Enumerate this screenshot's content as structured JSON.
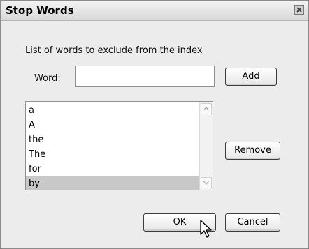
{
  "dialog": {
    "title": "Stop Words",
    "instructions": "List of words to exclude from the index",
    "word_label": "Word:",
    "word_value": "",
    "add_label": "Add",
    "remove_label": "Remove",
    "ok_label": "OK",
    "cancel_label": "Cancel",
    "words": [
      "a",
      "A",
      "the",
      "The",
      "for",
      "by"
    ],
    "selected_word": "by"
  },
  "icons": {
    "close": "close-icon",
    "scroll_up": "chevron-up-icon",
    "scroll_down": "chevron-down-icon",
    "cursor": "mouse-pointer-icon"
  },
  "colors": {
    "dialog_bg": "#ececec",
    "selection_bg": "#c8c8c8",
    "border": "#3c3c3c"
  }
}
